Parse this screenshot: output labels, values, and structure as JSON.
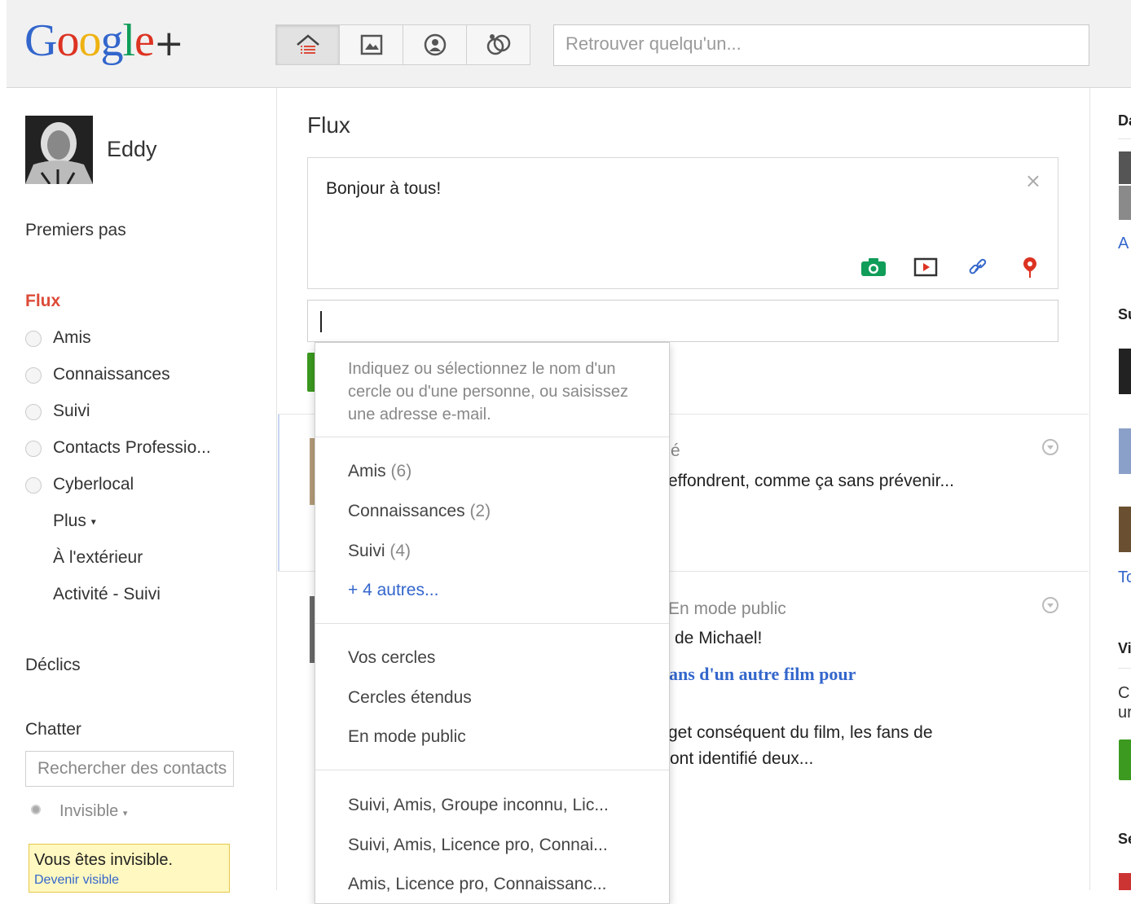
{
  "topbar": {
    "logo": {
      "g1": "G",
      "o1": "o",
      "o2": "o",
      "g2": "g",
      "l": "l",
      "e": "e",
      "plus": "+"
    },
    "nav": [
      {
        "icon": "home-icon",
        "active": true
      },
      {
        "icon": "photos-icon",
        "active": false
      },
      {
        "icon": "profile-icon",
        "active": false
      },
      {
        "icon": "circles-icon",
        "active": false
      }
    ],
    "search_placeholder": "Retrouver quelqu'un..."
  },
  "sidebar": {
    "user_name": "Eddy",
    "premiers_pas": "Premiers pas",
    "flux_title": "Flux",
    "circles": [
      "Amis",
      "Connaissances",
      "Suivi",
      "Contacts Professio...",
      "Cyberlocal"
    ],
    "more": "Plus",
    "outside": "À l'extérieur",
    "activity": "Activité - Suivi",
    "declics": "Déclics",
    "chat_title": "Chatter",
    "chat_search_placeholder": "Rechercher des contacts",
    "status": "Invisible",
    "invisible_notice": "Vous êtes invisible.",
    "become_visible": "Devenir visible"
  },
  "main": {
    "title": "Flux",
    "composer_text": "Bonjour à tous!",
    "close_symbol": "×",
    "post1": {
      "meta_tail": "é",
      "text_tail": "effondrent, comme ça sans prévenir..."
    },
    "post2": {
      "meta_tail": "En mode public",
      "line1": "de Michael!",
      "link_tail": "ans d'un autre film pour",
      "line3": "get conséquent du film, les fans de",
      "line4": "ont identifié deux..."
    }
  },
  "dropdown": {
    "hint": "Indiquez ou sélectionnez le nom d'un cercle ou d'une personne, ou saisissez une adresse e-mail.",
    "circles": [
      {
        "name": "Amis",
        "count": "(6)"
      },
      {
        "name": "Connaissances",
        "count": "(2)"
      },
      {
        "name": "Suivi",
        "count": "(4)"
      }
    ],
    "more": "+ 4 autres...",
    "scopes": [
      "Vos cercles",
      "Cercles étendus",
      "En mode public"
    ],
    "recent": [
      "Suivi, Amis, Groupe inconnu, Lic...",
      "Suivi, Amis, Licence pro, Connai...",
      "Amis, Licence pro, Connaissanc..."
    ]
  },
  "rightcol": {
    "h1": "Da",
    "link1": "A",
    "h2": "Su",
    "link2": "To",
    "h3": "Vi",
    "p1": "C",
    "p2": "ur",
    "h4": "Se"
  },
  "colors": {
    "accent_red": "#dd4b39",
    "link_blue": "#3366cc",
    "green": "#3b9a1f"
  }
}
